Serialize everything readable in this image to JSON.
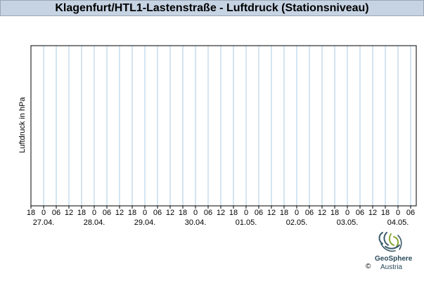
{
  "chart_data": {
    "type": "line",
    "title": "Klagenfurt/HTL1-Lastenstraße - Luftdruck (Stationsniveau)",
    "xlabel": "",
    "ylabel": "Luftdruck in hPa",
    "x_tick_labels": [
      "18",
      "0",
      "06",
      "12",
      "18",
      "0",
      "06",
      "12",
      "18",
      "0",
      "06",
      "12",
      "18",
      "0",
      "06",
      "12",
      "18",
      "0",
      "06",
      "12",
      "18",
      "0",
      "06",
      "12",
      "18",
      "0",
      "06",
      "12",
      "18",
      "0",
      "06"
    ],
    "date_labels": [
      "27.04.",
      "28.04.",
      "29.04.",
      "30.04.",
      "01.05.",
      "02.05.",
      "03.05.",
      "04.05."
    ],
    "grid": true,
    "series": []
  },
  "logo": {
    "name": "GeoSphere",
    "country": "Austria",
    "copyright": "©"
  },
  "colors": {
    "title_bg": "#c6d3e3",
    "grid": "#a9cbe3",
    "axis": "#000000"
  }
}
